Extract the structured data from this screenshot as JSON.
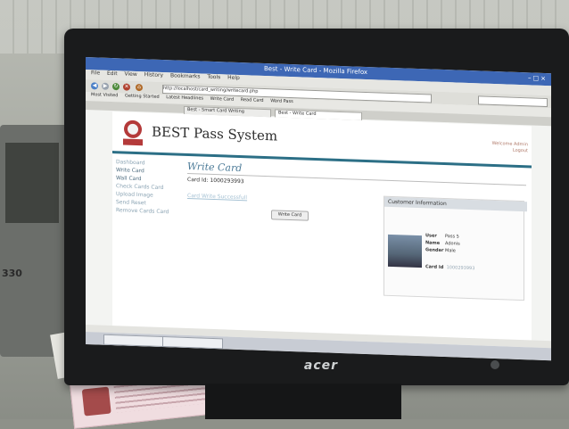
{
  "browser": {
    "window_title": "Best - Write Card - Mozilla Firefox",
    "menu": [
      "File",
      "Edit",
      "View",
      "History",
      "Bookmarks",
      "Tools",
      "Help"
    ],
    "address": "http://localhost/card_writing/writecard.php",
    "bookmarks": [
      "Most Visited",
      "Getting Started",
      "Latest Headlines",
      "Write Card",
      "Read Card",
      "Ward Pass"
    ],
    "tabs": [
      "Best - Smart Card Writing",
      "Best - Write Card"
    ]
  },
  "page": {
    "site_title": "BEST Pass System",
    "header_right": [
      "Welcome Admin",
      "Logout"
    ],
    "sidebar": {
      "heading": "Dashboard",
      "items": [
        "Write Card",
        "Wall Card",
        "Check Cards Card",
        "Upload Image",
        "Send Reset",
        "Remove Cards Card"
      ]
    },
    "main_title": "Write Card",
    "card_id_label": "Card Id: 1000293993",
    "card_link": "Card Write Successfull",
    "write_button": "Write Card",
    "info_panel": {
      "header": "Customer Information",
      "fields": [
        {
          "label": "User",
          "value": "Pass 5"
        },
        {
          "label": "Name",
          "value": "Adonis"
        },
        {
          "label": "Gender",
          "value": "Male"
        }
      ],
      "card_label": "Card Id",
      "card_value": "1000293993"
    }
  },
  "monitor": {
    "brand": "acer"
  },
  "desk": {
    "device_label": "330"
  },
  "colors": {
    "titlebar": "#3d67b5",
    "header_rule": "#2c6f86",
    "logo": "#b43a3a",
    "link": "#a6c2d4"
  }
}
